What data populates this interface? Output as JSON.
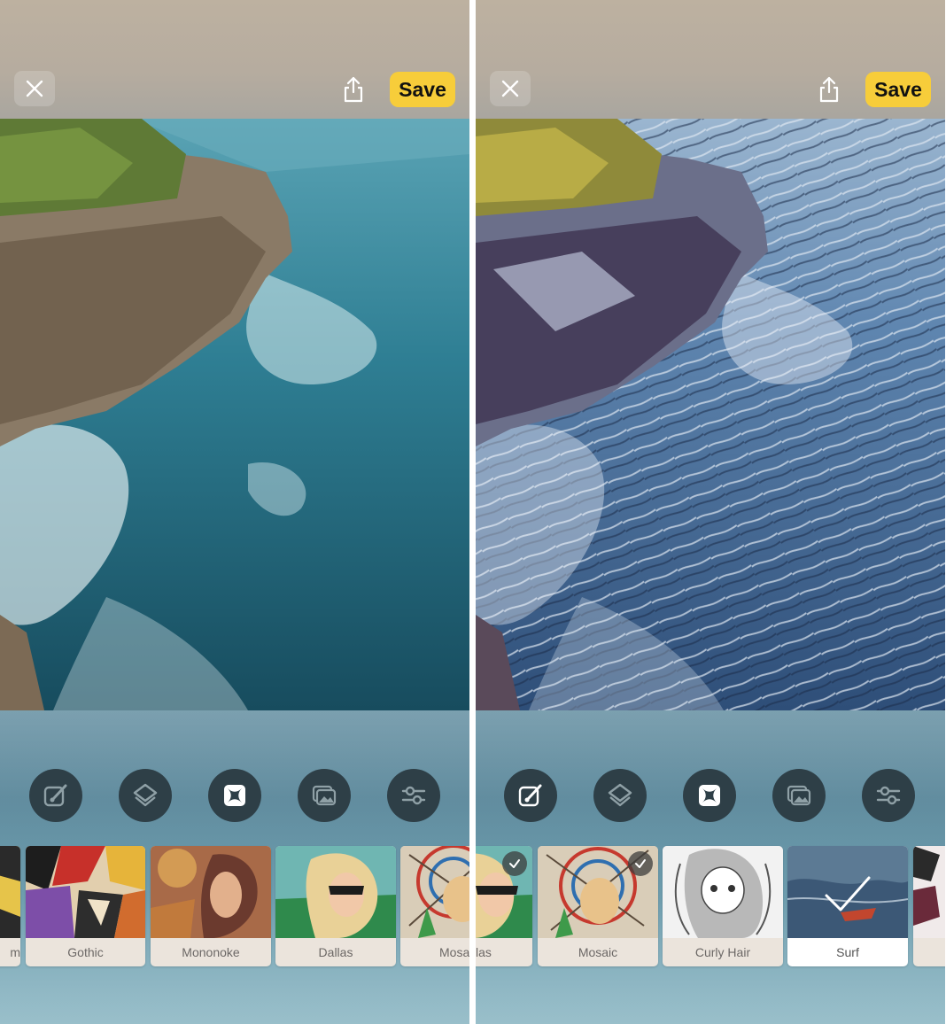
{
  "left": {
    "save_label": "Save",
    "styles": [
      "m",
      "Gothic",
      "Mononoke",
      "Dallas",
      "Mosa"
    ]
  },
  "right": {
    "save_label": "Save",
    "styles": [
      "las",
      "Mosaic",
      "Curly Hair",
      "Surf",
      ""
    ],
    "selected_style": "Surf"
  },
  "tools": [
    "edit-brush-icon",
    "layers-icon",
    "styles-icon",
    "backgrounds-icon",
    "adjust-sliders-icon"
  ],
  "colors": {
    "save": "#f7cd3a",
    "tool_bg": "#2e3f47"
  }
}
